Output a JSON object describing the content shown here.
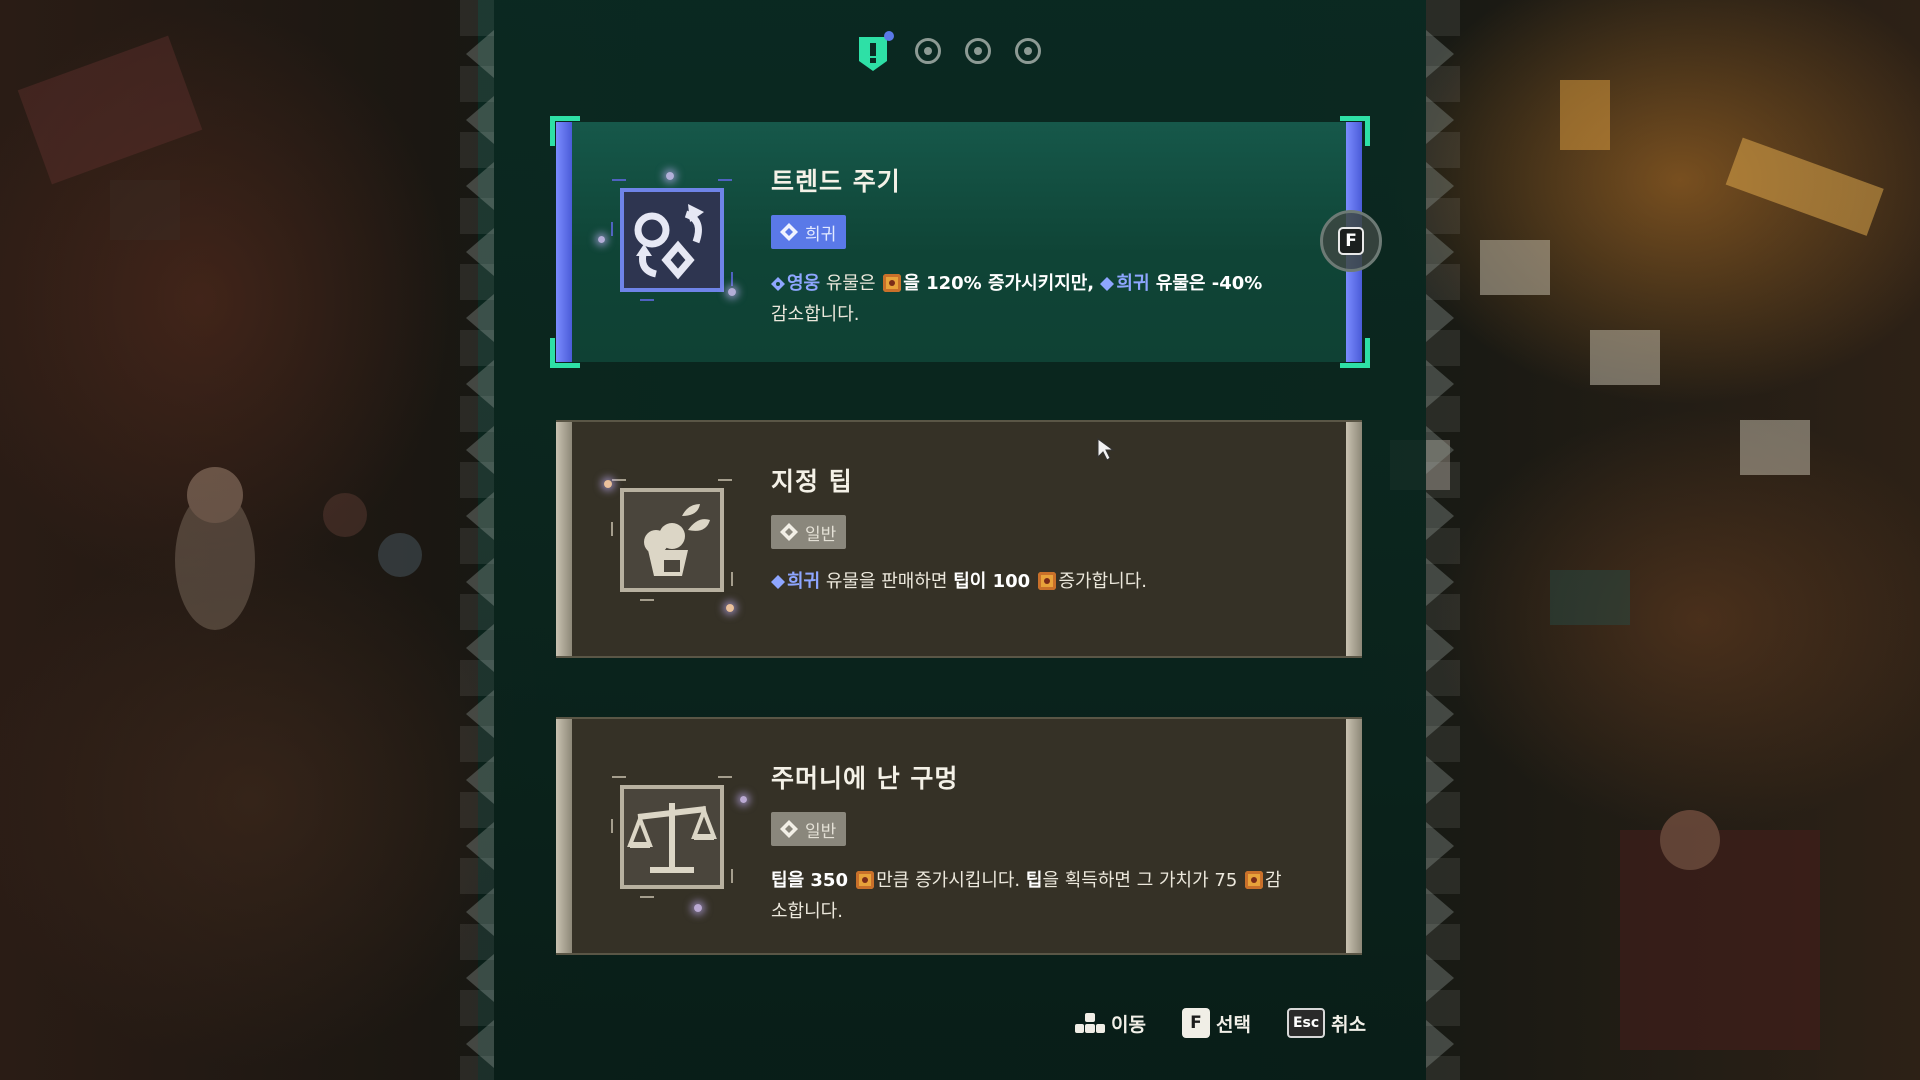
{
  "pager": {
    "total": 4,
    "active_index": 0
  },
  "cards": [
    {
      "title": "트렌드 주기",
      "rarity": "희귀",
      "selected": true,
      "icon": "cycle-arrows-icon",
      "desc": {
        "kw1": "영웅",
        "t1": " 유물은 ",
        "t2": "을 120% 증가시키지만, ",
        "kw2": "희귀",
        "t3": " 유물은 -40%",
        "t4": "감소합니다."
      }
    },
    {
      "title": "지정 팁",
      "rarity": "일반",
      "selected": false,
      "icon": "plant-pot-icon",
      "desc": {
        "kw1": "희귀",
        "t1": " 유물을 판매하면 ",
        "b1": "팁",
        "t2": "이 100 ",
        "t3": "증가합니다."
      }
    },
    {
      "title": "주머니에 난 구멍",
      "rarity": "일반",
      "selected": false,
      "icon": "balance-scale-icon",
      "desc": {
        "b1": "팁",
        "t1": "을 350 ",
        "t2": "만큼 증가시킵니다. ",
        "b2": "팁",
        "t3": "을 획득하면 그 가치가 75 ",
        "t4": "감",
        "t5": "소합니다."
      }
    }
  ],
  "select_key": "F",
  "hints": [
    {
      "key": "",
      "label": "이동",
      "icon": "dpad-icon"
    },
    {
      "key": "F",
      "label": "선택"
    },
    {
      "key": "Esc",
      "label": "취소"
    }
  ],
  "colors": {
    "panel": "#0f4436",
    "rare": "#5a79e8",
    "common": "#8a877c",
    "card_bg": "#353126",
    "accent": "#2ee0a6"
  }
}
